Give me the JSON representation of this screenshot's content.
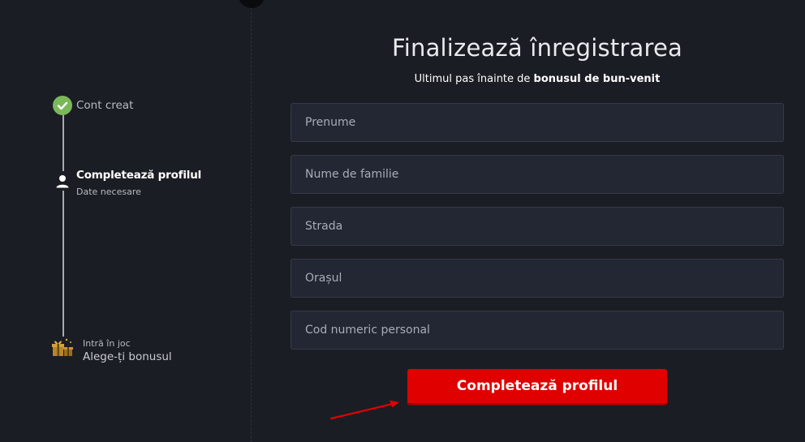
{
  "sidebar": {
    "steps": [
      {
        "title": "Cont creat",
        "status": "done"
      },
      {
        "title": "Completează profilul",
        "subtitle": "Date necesare",
        "status": "active"
      },
      {
        "pretitle": "Intră în joc",
        "title": "Alege-ți bonusul",
        "status": "pending"
      }
    ]
  },
  "main": {
    "title": "Finalizează înregistrarea",
    "subtitle_prefix": "Ultimul pas înainte de ",
    "subtitle_bold": "bonusul de bun-venit",
    "fields": [
      {
        "placeholder": "Prenume",
        "value": ""
      },
      {
        "placeholder": "Nume de familie",
        "value": ""
      },
      {
        "placeholder": "Strada",
        "value": ""
      },
      {
        "placeholder": "Orașul",
        "value": ""
      },
      {
        "placeholder": "Cod numeric personal",
        "value": ""
      }
    ],
    "submit_label": "Completează profilul"
  },
  "colors": {
    "background": "#1b1d24",
    "field_background": "#232733",
    "accent_red": "#e00000",
    "check_green": "#7ab85a"
  },
  "icons": [
    "check-icon",
    "user-icon",
    "gift-icon",
    "arrow-annotation"
  ]
}
